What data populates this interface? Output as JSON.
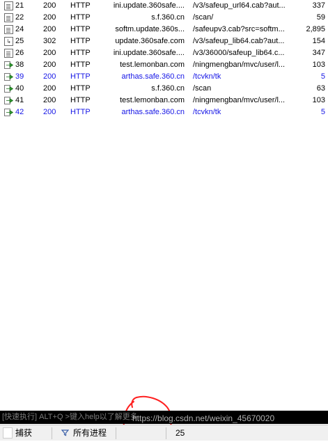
{
  "sessions": [
    {
      "num": "21",
      "result": "200",
      "protocol": "HTTP",
      "host": "ini.update.360safe....",
      "url": "/v3/safeup_url64.cab?aut...",
      "body": "337",
      "icon": "document-icon",
      "blue": false
    },
    {
      "num": "22",
      "result": "200",
      "protocol": "HTTP",
      "host": "s.f.360.cn",
      "url": "/scan/",
      "body": "59",
      "icon": "document-icon",
      "blue": false
    },
    {
      "num": "24",
      "result": "200",
      "protocol": "HTTP",
      "host": "softm.update.360s...",
      "url": "/safeupv3.cab?src=softm...",
      "body": "2,895",
      "icon": "document-icon",
      "blue": false
    },
    {
      "num": "25",
      "result": "302",
      "protocol": "HTTP",
      "host": "update.360safe.com",
      "url": "/v3/safeup_lib64.cab?aut...",
      "body": "154",
      "icon": "redirect-icon",
      "blue": false
    },
    {
      "num": "26",
      "result": "200",
      "protocol": "HTTP",
      "host": "ini.update.360safe....",
      "url": "/v3/36000/safeup_lib64.c...",
      "body": "347",
      "icon": "document-icon",
      "blue": false
    },
    {
      "num": "38",
      "result": "200",
      "protocol": "HTTP",
      "host": "test.lemonban.com",
      "url": "/ningmengban/mvc/user/l...",
      "body": "103",
      "icon": "arrow-icon",
      "blue": false
    },
    {
      "num": "39",
      "result": "200",
      "protocol": "HTTP",
      "host": "arthas.safe.360.cn",
      "url": "/tcvkn/tk",
      "body": "5",
      "icon": "arrow-icon",
      "blue": true
    },
    {
      "num": "40",
      "result": "200",
      "protocol": "HTTP",
      "host": "s.f.360.cn",
      "url": "/scan",
      "body": "63",
      "icon": "arrow-icon",
      "blue": false
    },
    {
      "num": "41",
      "result": "200",
      "protocol": "HTTP",
      "host": "test.lemonban.com",
      "url": "/ningmengban/mvc/user/l...",
      "body": "103",
      "icon": "arrow-icon",
      "blue": false
    },
    {
      "num": "42",
      "result": "200",
      "protocol": "HTTP",
      "host": "arthas.safe.360.cn",
      "url": "/tcvkn/tk",
      "body": "5",
      "icon": "arrow-icon",
      "blue": true
    }
  ],
  "quickexec": {
    "placeholder": "[快速执行] ALT+Q >键入help以了解更多"
  },
  "statusbar": {
    "capture": "捕获",
    "process": "所有进程",
    "count": "25"
  },
  "watermark": "https://blog.csdn.net/weixin_45670020",
  "colors": {
    "link_blue": "#1515e6",
    "cmd_bg": "#000000",
    "annotation_red": "#ff2020",
    "arrow_green": "#2e9b2e"
  }
}
